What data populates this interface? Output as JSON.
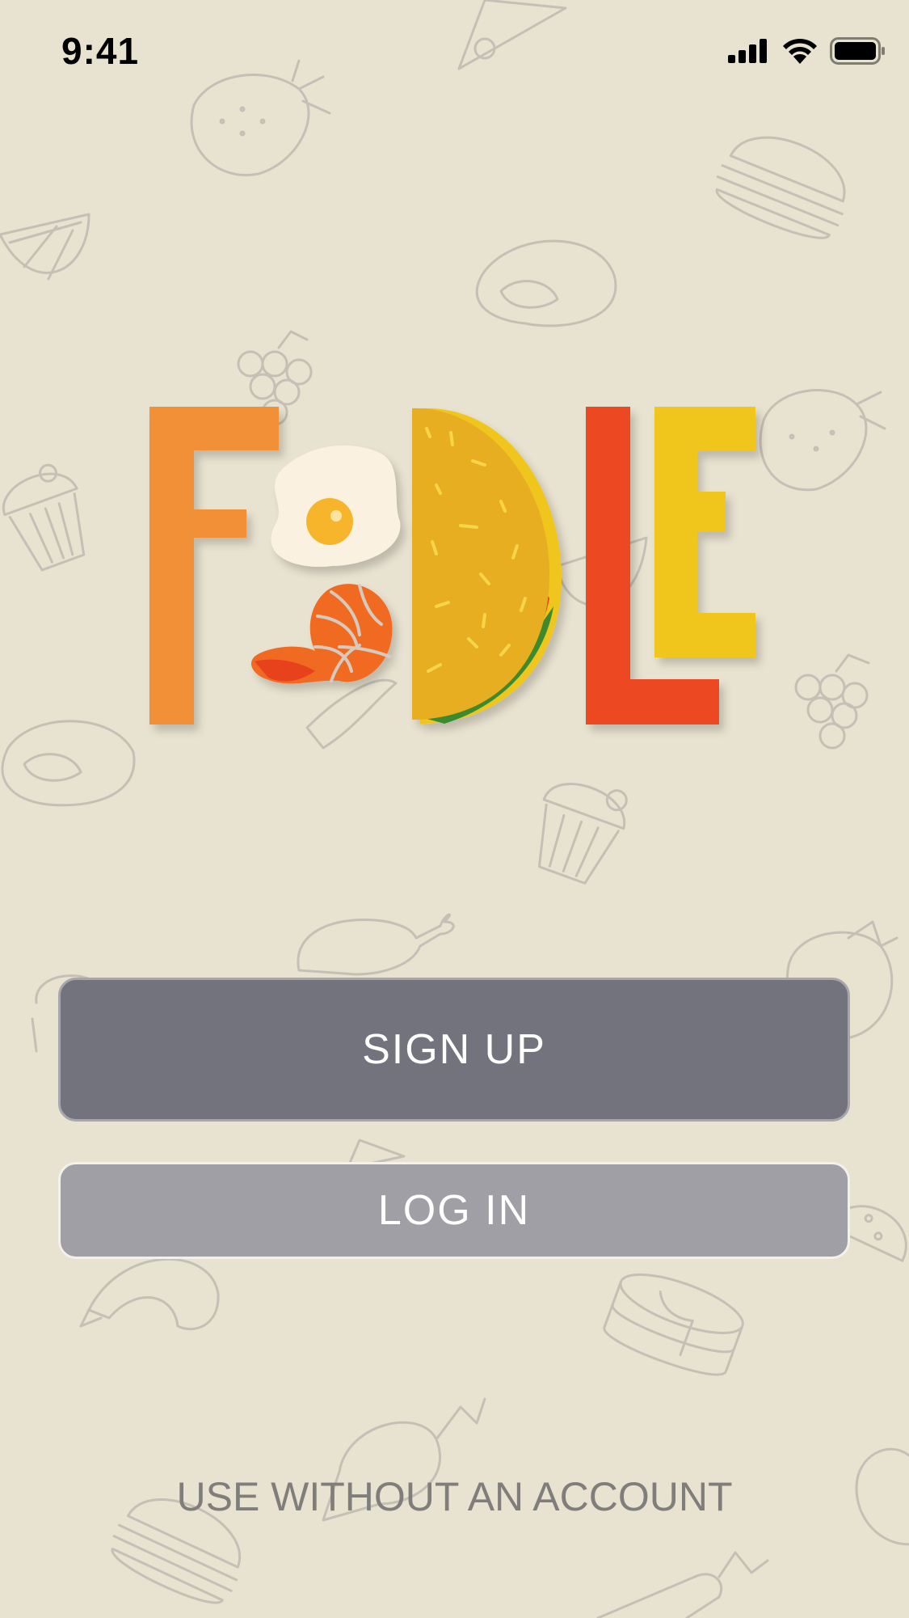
{
  "status_bar": {
    "time": "9:41"
  },
  "app": {
    "logo_text": "FOODLE"
  },
  "actions": {
    "sign_up_label": "SIGN UP",
    "log_in_label": "LOG IN",
    "guest_label": "USE WITHOUT AN ACCOUNT"
  },
  "colors": {
    "background": "#e8e2d0",
    "sign_up_button": "#73737e",
    "log_in_button": "#a09fa6",
    "logo_f": "#f29037",
    "logo_d_taco": "#e8ae24",
    "logo_l": "#ec4924",
    "logo_e": "#f0c51d"
  }
}
